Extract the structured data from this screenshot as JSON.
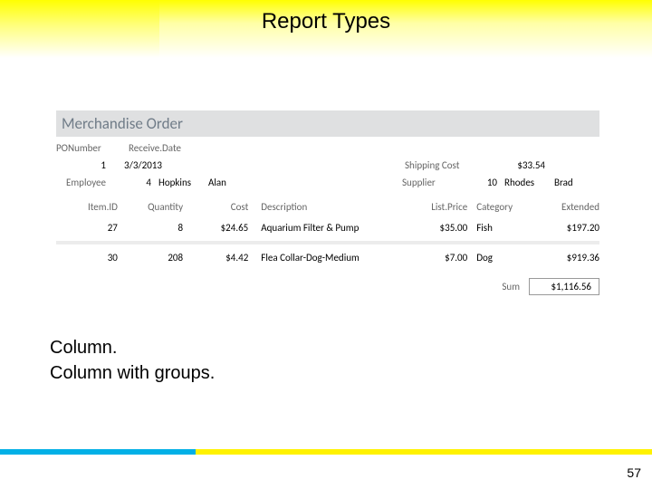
{
  "title": "Report Types",
  "report": {
    "heading": "Merchandise Order",
    "header_fields": {
      "po_label": "PONumber",
      "po_value": "1",
      "recv_label": "Receive.Date",
      "recv_value": "3/3/2013",
      "ship_label": "Shipping Cost",
      "ship_value": "$33.54",
      "emp_label": "Employee",
      "emp_id": "4",
      "emp_last": "Hopkins",
      "emp_first": "Alan",
      "supp_label": "Supplier",
      "supp_id": "10",
      "supp_last": "Rhodes",
      "supp_first": "Brad"
    },
    "columns": {
      "item": "Item.ID",
      "qty": "Quantity",
      "cost": "Cost",
      "desc": "Description",
      "list": "List.Price",
      "cat": "Category",
      "ext": "Extended"
    },
    "rows": [
      {
        "item": "27",
        "qty": "8",
        "cost": "$24.65",
        "desc": "Aquarium Filter & Pump",
        "list": "$35.00",
        "cat": "Fish",
        "ext": "$197.20"
      },
      {
        "item": "30",
        "qty": "208",
        "cost": "$4.42",
        "desc": "Flea Collar-Dog-Medium",
        "list": "$7.00",
        "cat": "Dog",
        "ext": "$919.36"
      }
    ],
    "sum_label": "Sum",
    "sum_value": "$1,116.56"
  },
  "bullets": {
    "line1": "Column.",
    "line2": "Column with groups."
  },
  "page_number": "57"
}
